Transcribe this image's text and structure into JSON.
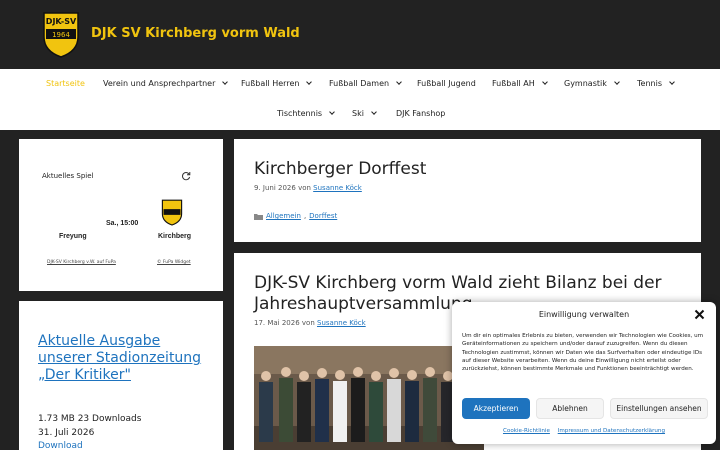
{
  "site": {
    "title": "DJK SV Kirchberg vorm Wald",
    "logo_text_top": "DJK-SV",
    "logo_year": "1964"
  },
  "nav": {
    "row1": [
      {
        "label": "Startseite",
        "active": true,
        "dropdown": false
      },
      {
        "label": "Verein und Ansprechpartner",
        "dropdown": true
      },
      {
        "label": "Fußball Herren",
        "dropdown": true
      },
      {
        "label": "Fußball Damen",
        "dropdown": true
      },
      {
        "label": "Fußball Jugend",
        "dropdown": false
      },
      {
        "label": "Fußball AH",
        "dropdown": true
      },
      {
        "label": "Gymnastik",
        "dropdown": true
      },
      {
        "label": "Tennis",
        "dropdown": true
      }
    ],
    "row2": [
      {
        "label": "Tischtennis",
        "dropdown": true
      },
      {
        "label": "Ski",
        "dropdown": true
      },
      {
        "label": "DJK Fanshop",
        "dropdown": false
      }
    ]
  },
  "widget_game": {
    "title": "Aktuelles Spiel",
    "home_team": "Freyung",
    "time": "Sa., 15:00",
    "away_team": "Kirchberg",
    "footer_left": "DJK-SV Kirchberg v.W. auf FuPa",
    "footer_right": "© FuPa Widget"
  },
  "widget_download": {
    "title": "Aktuelle Ausgabe unserer Stadionzeitung „Der Kritiker\"",
    "meta": "1.73 MB 23 Downloads",
    "date": "31. Juli 2026",
    "link": "Download"
  },
  "articles": [
    {
      "title": "Kirchberger Dorffest",
      "date": "9. Juni 2026",
      "by": "von",
      "author": "Susanne Köck",
      "categories": [
        "Allgemein",
        "Dorffest"
      ]
    },
    {
      "title": "DJK-SV Kirchberg vorm Wald zieht Bilanz bei der Jahreshauptversammlung",
      "date": "17. Mai 2026",
      "by": "von",
      "author": "Susanne Köck"
    }
  ],
  "cookie": {
    "title": "Einwilligung verwalten",
    "text": "Um dir ein optimales Erlebnis zu bieten, verwenden wir Technologien wie Cookies, um Geräteinformationen zu speichern und/oder darauf zuzugreifen. Wenn du diesen Technologien zustimmst, können wir Daten wie das Surfverhalten oder eindeutige IDs auf dieser Website verarbeiten. Wenn du deine Einwilligung nicht erteilst oder zurückziehst, können bestimmte Merkmale und Funktionen beeinträchtigt werden.",
    "accept": "Akzeptieren",
    "deny": "Ablehnen",
    "settings": "Einstellungen ansehen",
    "link_cookie": "Cookie-Richtlinie",
    "link_privacy": "Impressum und Datenschutzerklärung"
  },
  "colors": {
    "accent": "#f1c40f",
    "link": "#1e73be",
    "header_bg": "#222222"
  }
}
